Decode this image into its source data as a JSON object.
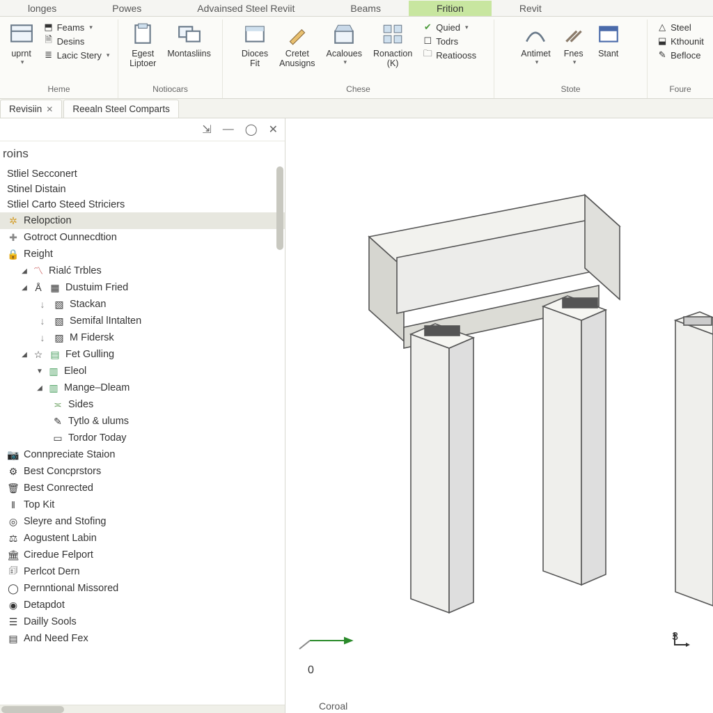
{
  "ribbonTabs": {
    "t0": "longes",
    "t1": "Powes",
    "t2": "Advainsed Steel Reviit",
    "t3": "Beams",
    "t4": "Frition",
    "t5": "Revit"
  },
  "ribbon": {
    "heme": {
      "label": "Heme",
      "feams": "Feams",
      "desins": "Desins",
      "uprnt": "uprnt",
      "lacic": "Lacic Stery"
    },
    "notiocars": {
      "label": "Notiocars",
      "egest": "Egest\nLiptoer",
      "montaslins": "Montasliins"
    },
    "chese": {
      "label": "Chese",
      "dioces": "Dioces\nFit",
      "cretet": "Cretet\nAnusigns",
      "acaloues": "Acaloues",
      "ronaction": "Ronaction\n(K)",
      "quied": "Quied",
      "todrs": "Todrs",
      "reatiooss": "Reatiooss"
    },
    "stote": {
      "label": "Stote",
      "antimet": "Antimet",
      "fnes": "Fnes",
      "stant": "Stant"
    },
    "foure": {
      "label": "Foure",
      "steel": "Steel",
      "ktmouni": "Kthounit",
      "befloce": "Befloce"
    }
  },
  "docTabs": {
    "t0": "Revisiin",
    "t1": "Reealn Steel Comparts"
  },
  "side": {
    "title": "roins",
    "items": {
      "i0": "Stliel Secconert",
      "i1": "Stinel Distain",
      "i2": "Stliel Carto Steed Striciers",
      "i3": "Relopction",
      "i4": "Gotroct Ounnecdtion",
      "i5": "Reight",
      "i6": "Rialć Trbles",
      "i7": "Dustuim Fried",
      "i8": "Stackan",
      "i9": "Semifal lIntalten",
      "i10": "M Fidersk",
      "i11": "Fet Gulling",
      "i12": "Eleol",
      "i13": "Mange–Dleam",
      "i14": "Sides",
      "i15": "Tytlo & ulums",
      "i16": "Tordor Today",
      "i17": "Connpreciate Staion",
      "i18": "Best Concprstors",
      "i19": "Best Conrected",
      "i20": "Top Kit",
      "i21": "Sleyre and Stofing",
      "i22": "Aogustent Labin",
      "i23": "Ciredue Felport",
      "i24": "Perlcot Dern",
      "i25": "Pernntional Missored",
      "i26": "Detapdot",
      "i27": "Dailly Sools",
      "i28": "And Need Fex"
    }
  },
  "viewport": {
    "zero": "0",
    "axis": "3",
    "status": "Coroal"
  }
}
